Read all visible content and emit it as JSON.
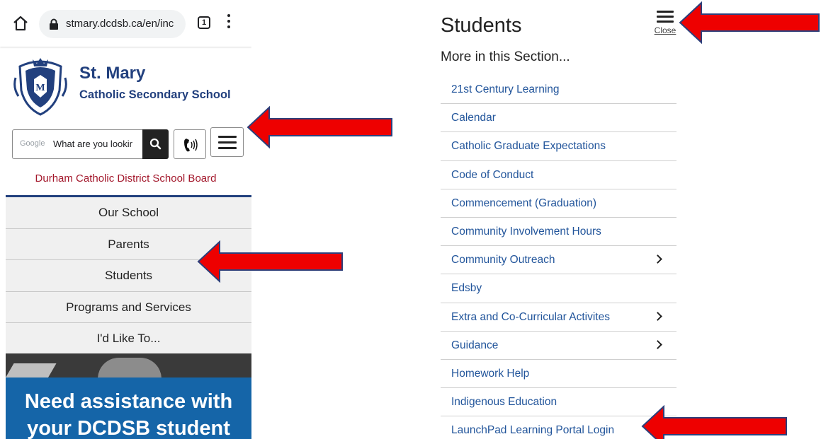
{
  "left_screen": {
    "browser": {
      "url": "stmary.dcdsb.ca/en/inc",
      "tab_count": "1"
    },
    "school": {
      "name": "St. Mary",
      "subtitle": "Catholic Secondary School"
    },
    "search": {
      "brand": "Google",
      "placeholder": "What are you lookir"
    },
    "board_name": "Durham Catholic District School Board",
    "nav_items": [
      {
        "label": "Our School"
      },
      {
        "label": "Parents"
      },
      {
        "label": "Students"
      },
      {
        "label": "Programs and Services"
      },
      {
        "label": "I'd Like To..."
      }
    ],
    "banner": {
      "line1": "Need assistance with",
      "line2": "your DCDSB student"
    }
  },
  "right_screen": {
    "title": "Students",
    "close_label": "Close",
    "section_heading": "More in this Section...",
    "items": [
      {
        "label": "21st Century Learning"
      },
      {
        "label": "Calendar"
      },
      {
        "label": "Catholic Graduate Expectations"
      },
      {
        "label": "Code of Conduct"
      },
      {
        "label": "Commencement (Graduation)"
      },
      {
        "label": "Community Involvement Hours"
      },
      {
        "label": "Community Outreach",
        "has_submenu": true
      },
      {
        "label": "Edsby"
      },
      {
        "label": "Extra and Co-Curricular Activites",
        "has_submenu": true
      },
      {
        "label": "Guidance",
        "has_submenu": true
      },
      {
        "label": "Homework Help"
      },
      {
        "label": "Indigenous Education"
      },
      {
        "label": "LaunchPad Learning Portal Login"
      }
    ]
  },
  "annotation_color": "#ee0000"
}
